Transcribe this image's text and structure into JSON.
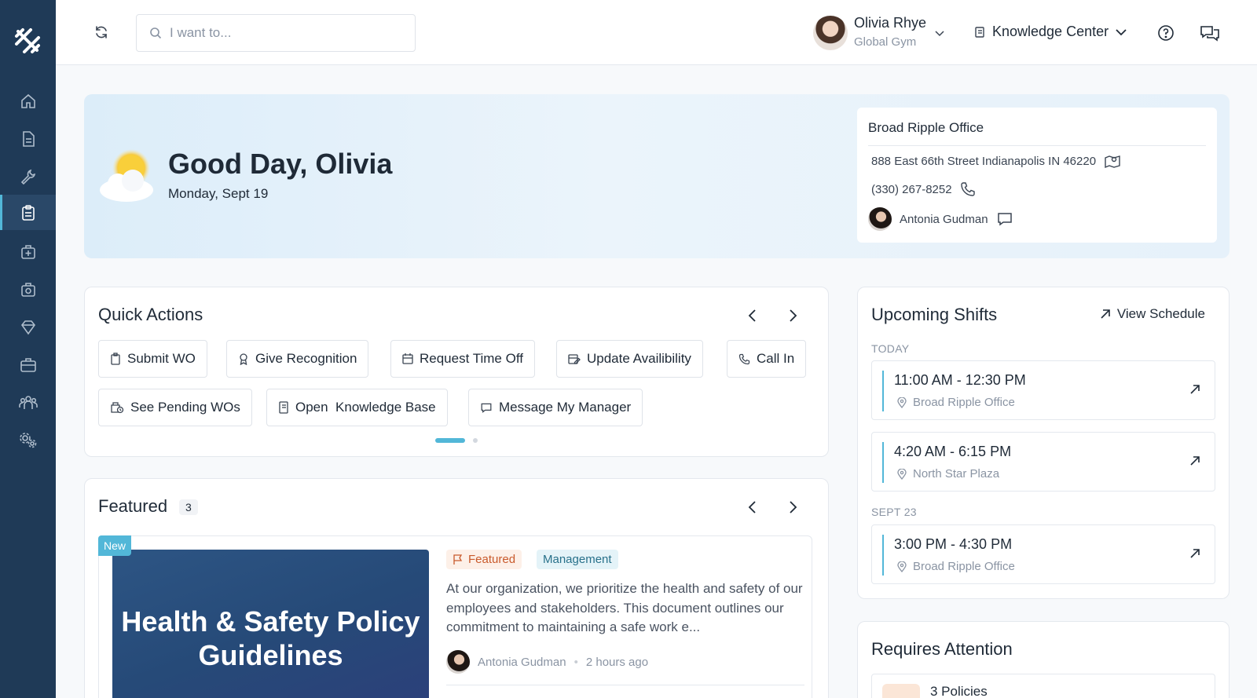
{
  "sidebar": {
    "logo": "logo-icon",
    "items": [
      {
        "icon": "home-icon"
      },
      {
        "icon": "document-icon"
      },
      {
        "icon": "wrench-icon"
      },
      {
        "icon": "clipboard-icon",
        "active": true
      },
      {
        "icon": "first-aid-icon"
      },
      {
        "icon": "medical-bag-icon"
      },
      {
        "icon": "gem-icon"
      },
      {
        "icon": "briefcase-icon"
      },
      {
        "icon": "team-icon"
      },
      {
        "icon": "settings-icon"
      }
    ]
  },
  "topbar": {
    "search_placeholder": "I want to...",
    "user_name": "Olivia Rhye",
    "user_org": "Global Gym",
    "knowledge_center": "Knowledge Center"
  },
  "hero": {
    "greeting": "Good Day, Olivia",
    "date": "Monday, Sept 19",
    "office": {
      "title": "Broad Ripple Office",
      "address": "888 East 66th Street Indianapolis IN 46220",
      "phone": "(330) 267-8252",
      "contact": "Antonia Gudman"
    }
  },
  "quick_actions": {
    "title": "Quick Actions",
    "buttons": [
      {
        "label": "Submit WO",
        "icon": "clipboard-icon"
      },
      {
        "label": "Give Recognition",
        "icon": "award-icon"
      },
      {
        "label": "Request Time Off",
        "icon": "calendar-icon"
      },
      {
        "label": "Update Availibility",
        "icon": "calendar-edit-icon"
      },
      {
        "label": "Call In",
        "icon": "phone-icon"
      },
      {
        "label": "See Pending WOs",
        "icon": "pending-icon"
      },
      {
        "label": "Open  Knowledge Base",
        "icon": "book-icon"
      },
      {
        "label": "Message My Manager",
        "icon": "message-icon"
      }
    ]
  },
  "featured": {
    "title": "Featured",
    "count": "3",
    "new_badge": "New",
    "image_title": "Health & Safety Policy Guidelines",
    "tag_featured": "Featured",
    "tag_category": "Management",
    "description": "At our organization, we prioritize the health and safety of our employees and stakeholders. This document outlines our commitment to maintaining a safe work e...",
    "author": "Antonia Gudman",
    "time": "2 hours ago"
  },
  "shifts": {
    "title": "Upcoming Shifts",
    "view_schedule": "View Schedule",
    "groups": [
      {
        "label": "TODAY",
        "items": [
          {
            "time": "11:00 AM - 12:30 PM",
            "location": "Broad Ripple Office"
          },
          {
            "time": "4:20 AM - 6:15 PM",
            "location": "North Star Plaza"
          }
        ]
      },
      {
        "label": "SEPT 23",
        "items": [
          {
            "time": "3:00 PM - 4:30 PM",
            "location": "Broad Ripple Office"
          }
        ]
      }
    ]
  },
  "attention": {
    "title": "Requires Attention",
    "items": [
      {
        "label": "3 Policies"
      }
    ]
  },
  "colors": {
    "sidebar": "#1f3a57",
    "accent": "#52b7d8",
    "text": "#1f2a37"
  }
}
